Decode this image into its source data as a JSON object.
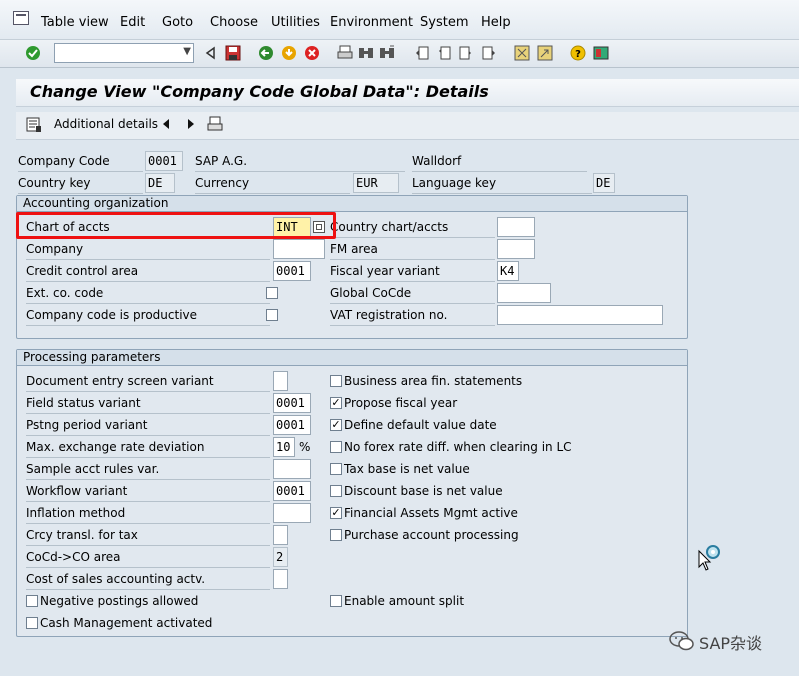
{
  "menu": {
    "items": [
      "Table view",
      "Edit",
      "Goto",
      "Choose",
      "Utilities",
      "Environment",
      "System",
      "Help"
    ]
  },
  "title": "Change View \"Company Code Global Data\": Details",
  "apptoolbar": {
    "additional_details": "Additional details"
  },
  "header": {
    "company_code_label": "Company Code",
    "company_code": "0001",
    "company_name": "SAP A.G.",
    "city": "Walldorf",
    "country_key_label": "Country key",
    "country_key": "DE",
    "currency_label": "Currency",
    "currency": "EUR",
    "language_key_label": "Language key",
    "language_key": "DE"
  },
  "accounting": {
    "title": "Accounting organization",
    "chart_label": "Chart of accts",
    "chart_value": "INT",
    "company_label": "Company",
    "company_value": "",
    "credit_label": "Credit control area",
    "credit_value": "0001",
    "ext_label": "Ext. co. code",
    "productive_label": "Company code is productive",
    "country_chart_label": "Country chart/accts",
    "fm_area_label": "FM area",
    "fy_variant_label": "Fiscal year variant",
    "fy_variant": "K4",
    "global_cocde_label": "Global CoCde",
    "vat_label": "VAT registration no."
  },
  "processing": {
    "title": "Processing parameters",
    "left": [
      {
        "label": "Document entry screen variant",
        "value": ""
      },
      {
        "label": "Field status variant",
        "value": "0001"
      },
      {
        "label": "Pstng period variant",
        "value": "0001"
      },
      {
        "label": "Max. exchange rate deviation",
        "value": "10"
      },
      {
        "label": "Sample acct rules var.",
        "value": ""
      },
      {
        "label": "Workflow variant",
        "value": "0001"
      },
      {
        "label": "Inflation method",
        "value": ""
      },
      {
        "label": "Crcy transl. for tax",
        "value": ""
      },
      {
        "label": "CoCd->CO area",
        "value": "2"
      },
      {
        "label": "Cost of sales accounting actv.",
        "value": ""
      }
    ],
    "percent_unit": "%",
    "neg_postings_label": "Negative postings allowed",
    "cash_mgmt_label": "Cash Management activated",
    "right": [
      {
        "label": "Business area fin. statements",
        "checked": false
      },
      {
        "label": "Propose fiscal year",
        "checked": true
      },
      {
        "label": "Define default value date",
        "checked": true
      },
      {
        "label": "No forex rate diff. when clearing in LC",
        "checked": false
      },
      {
        "label": "Tax base is net value",
        "checked": false
      },
      {
        "label": "Discount base is net value",
        "checked": false
      },
      {
        "label": "Financial Assets Mgmt active",
        "checked": true
      },
      {
        "label": "Purchase account processing",
        "checked": false
      }
    ],
    "amount_split_label": "Enable amount split"
  },
  "watermark": "SAP杂谈",
  "colors": {
    "highlight": "#ee1111",
    "field_bg": "#ffffff",
    "readonly_bg": "#e7edf2",
    "active_field": "#fff2a8"
  }
}
